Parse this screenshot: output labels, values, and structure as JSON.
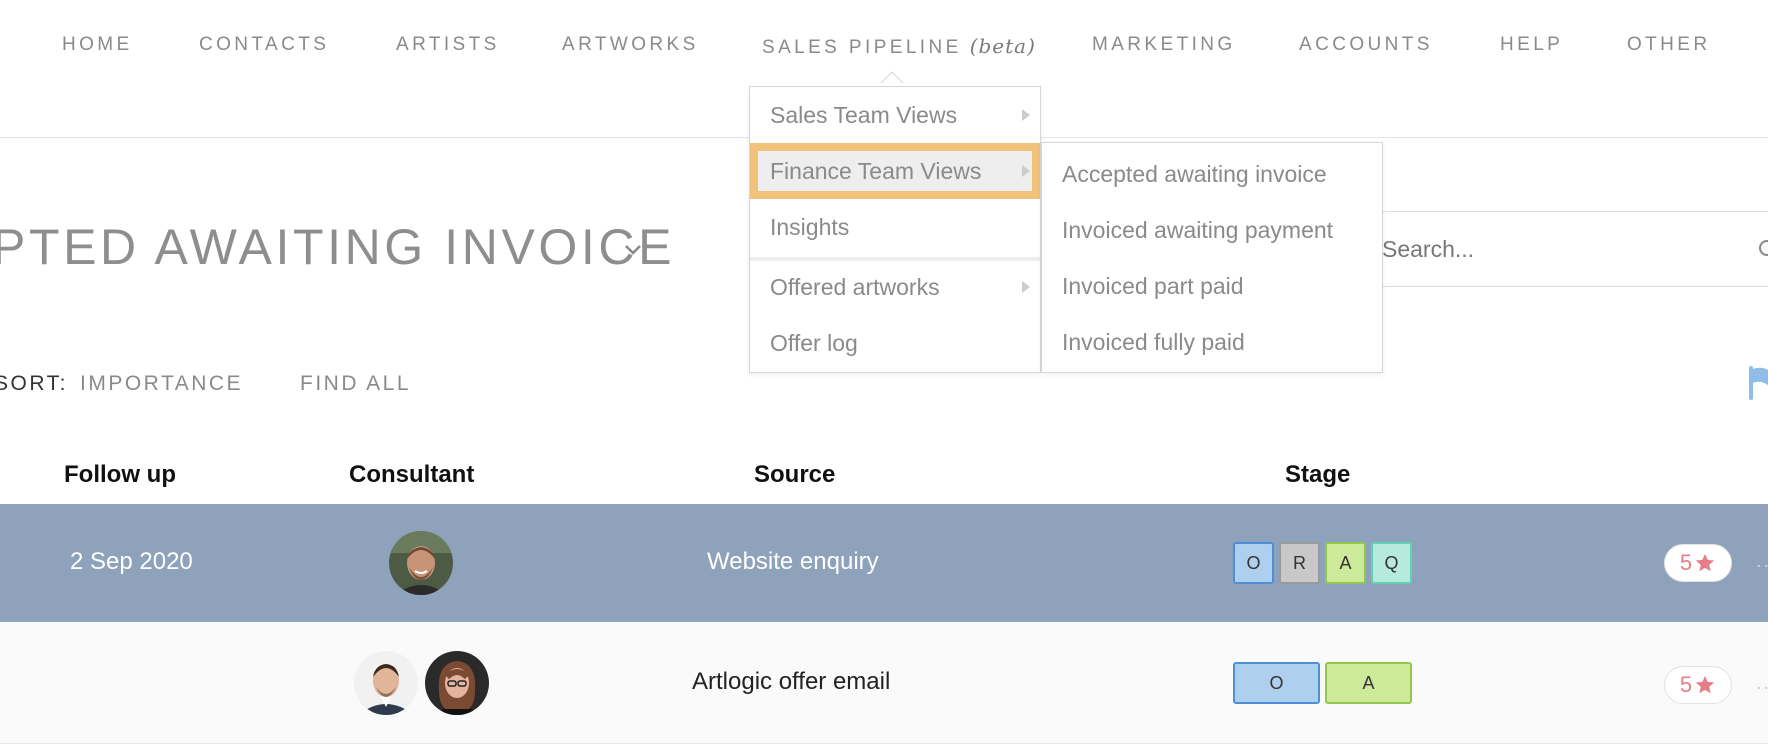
{
  "nav": {
    "items": [
      {
        "label": "HOME"
      },
      {
        "label": "CONTACTS"
      },
      {
        "label": "ARTISTS"
      },
      {
        "label": "ARTWORKS"
      },
      {
        "label": "SALES PIPELINE",
        "badge": "(beta)"
      },
      {
        "label": "MARKETING"
      },
      {
        "label": "ACCOUNTS"
      },
      {
        "label": "HELP"
      },
      {
        "label": "OTHER"
      }
    ]
  },
  "dropdown": {
    "items": [
      {
        "label": "Sales Team Views",
        "has_submenu": true
      },
      {
        "label": "Finance Team Views",
        "has_submenu": true,
        "highlighted": true
      },
      {
        "label": "Insights"
      },
      {
        "label": "Offered artworks",
        "has_submenu": true
      },
      {
        "label": "Offer log"
      }
    ],
    "submenu": {
      "items": [
        {
          "label": "Accepted awaiting invoice"
        },
        {
          "label": "Invoiced awaiting payment"
        },
        {
          "label": "Invoiced part paid"
        },
        {
          "label": "Invoiced fully paid"
        }
      ]
    }
  },
  "page": {
    "title": "PTED AWAITING INVOICE"
  },
  "search": {
    "placeholder": "Search..."
  },
  "sort": {
    "label": "SORT:",
    "value": "IMPORTANCE",
    "find_all": "FIND ALL"
  },
  "table": {
    "headers": {
      "follow_up": "Follow up",
      "consultant": "Consultant",
      "source": "Source",
      "stage": "Stage"
    },
    "rows": [
      {
        "follow_up": "2 Sep 2020",
        "source": "Website enquiry",
        "stages": [
          "O",
          "R",
          "A",
          "Q"
        ],
        "rating": "5",
        "selected": true
      },
      {
        "follow_up": "",
        "source": "Artlogic offer email",
        "stages": [
          "O",
          "A"
        ],
        "rating": "5",
        "selected": false
      }
    ]
  },
  "colors": {
    "selected_row": "#8fa2bb",
    "menu_highlight": "#f3c27a",
    "rating_star": "#e87d8a",
    "flag": "#8fbde8"
  }
}
